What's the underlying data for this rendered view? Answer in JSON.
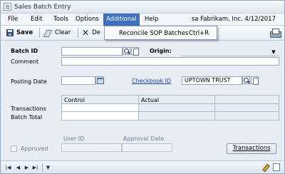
{
  "window": {
    "title": "Sales Batch Entry"
  },
  "menu": {
    "items": [
      "File",
      "Edit",
      "Tools",
      "Options",
      "Additional",
      "Help"
    ],
    "status": "sa  Fabrikam, Inc.  4/12/2017"
  },
  "dropdown": {
    "item": "Reconcile SOP Batches",
    "shortcut": "Ctrl+R"
  },
  "toolbar": {
    "save": "Save",
    "clear": "Clear",
    "delete_partial": "De"
  },
  "form": {
    "batch_id_label": "Batch ID",
    "origin_label": "Origin:",
    "comment_label": "Comment",
    "posting_date_label": "Posting Date",
    "checkbook_id_label": "Checkbook ID",
    "checkbook_id_value": "UPTOWN TRUST",
    "control_header": "Control",
    "actual_header": "Actual",
    "transactions_label": "Transactions",
    "batch_total_label": "Batch Total",
    "user_id_label": "User ID",
    "approval_date_label": "Approval Date",
    "approved_label": "Approved",
    "transactions_button": "Transactions"
  },
  "icons": {
    "lookup": "lookup-icon",
    "note": "note-icon",
    "calendar": "calendar-icon",
    "printer": "printer-icon"
  }
}
